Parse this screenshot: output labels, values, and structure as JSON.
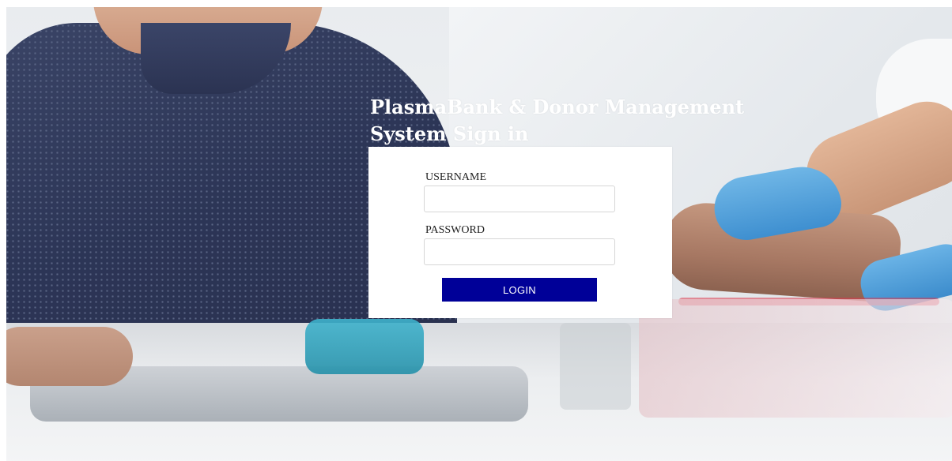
{
  "page": {
    "title_line1": "PlasmaBank & Donor Management",
    "title_line2": "System Sign in"
  },
  "form": {
    "username_label": "USERNAME",
    "username_value": "",
    "password_label": "PASSWORD",
    "password_value": "",
    "login_label": "LOGIN"
  },
  "colors": {
    "login_button": "#000098",
    "panel_background": "#ffffff",
    "title_text": "#ffffff"
  }
}
